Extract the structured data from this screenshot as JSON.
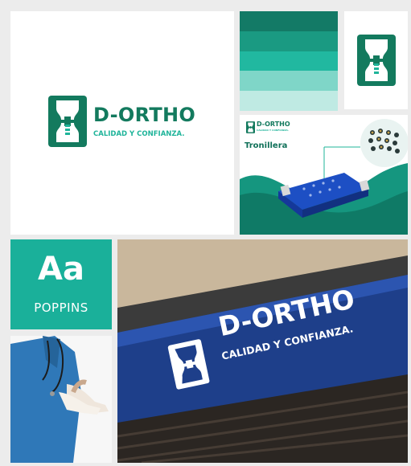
{
  "logo": {
    "brand": "D-ORTHO",
    "tagline": "CALIDAD Y CONFIANZA.",
    "icon": "knee-joint-logo-icon"
  },
  "palette": {
    "swatches": [
      "#137a66",
      "#1a9a82",
      "#21b8a0",
      "#7fd6c8",
      "#bfeae3"
    ]
  },
  "colors": {
    "brand_dark": "#137a5e",
    "brand_accent": "#1fb49a",
    "sign_blue": "#1e3f8a"
  },
  "product": {
    "brand": "D-ORTHO",
    "tagline": "CALIDAD Y CONFIANZA.",
    "title": "Tronillera"
  },
  "typography": {
    "sample": "Aa",
    "font_name": "POPPINS"
  },
  "signage": {
    "brand": "D-ORTHO",
    "tagline": "CALIDAD Y CONFIANZA."
  }
}
